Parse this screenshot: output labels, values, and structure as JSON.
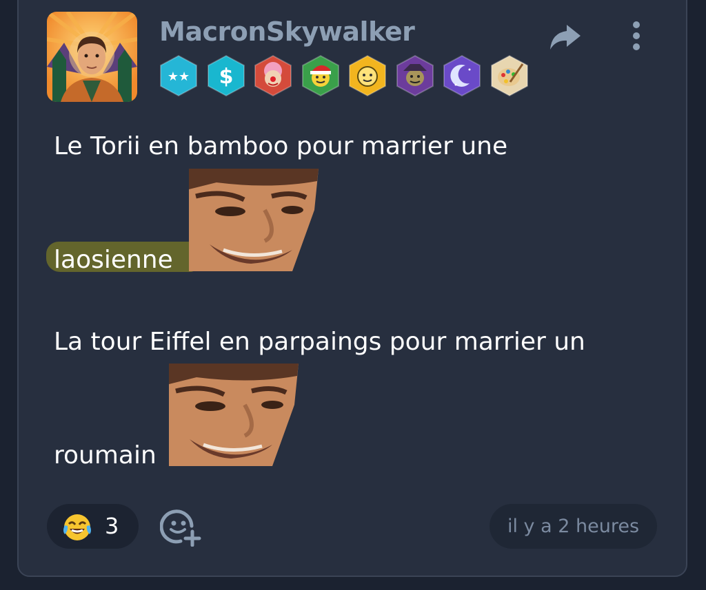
{
  "post": {
    "username": "MacronSkywalker",
    "avatar_icon": "portrait-avatar",
    "badges": [
      {
        "icon": "two-stars-badge-icon",
        "color": "#25b6d6"
      },
      {
        "icon": "dollar-badge-icon",
        "color": "#19b7cf"
      },
      {
        "icon": "clown-badge-icon",
        "color": "#d44b3b"
      },
      {
        "icon": "santa-smiley-badge-icon",
        "color": "#3aa04a"
      },
      {
        "icon": "smiley-badge-icon",
        "color": "#f2b51f"
      },
      {
        "icon": "goblin-badge-icon",
        "color": "#6c3c9c"
      },
      {
        "icon": "moon-badge-icon",
        "color": "#6a4ac8"
      },
      {
        "icon": "palette-badge-icon",
        "color": "#e8d6b0"
      }
    ],
    "lines": [
      "Le Torii en bamboo pour marrier une",
      "laosienne",
      "La tour Eiffel en parpaings pour marrier un",
      "roumain"
    ],
    "emotes": [
      "laughing-face-emote",
      "laughing-face-emote"
    ]
  },
  "footer": {
    "reaction_icon": "tears-of-joy-emoji-icon",
    "reaction_count": "3",
    "add_reaction_icon": "add-reaction-icon",
    "timestamp": "il y a 2 heures"
  },
  "colors": {
    "background": "#1b2230",
    "card": "#272f3f",
    "username": "#8d9fb4",
    "muted": "#7b8aa0",
    "highlight": "#6a6b2a"
  }
}
